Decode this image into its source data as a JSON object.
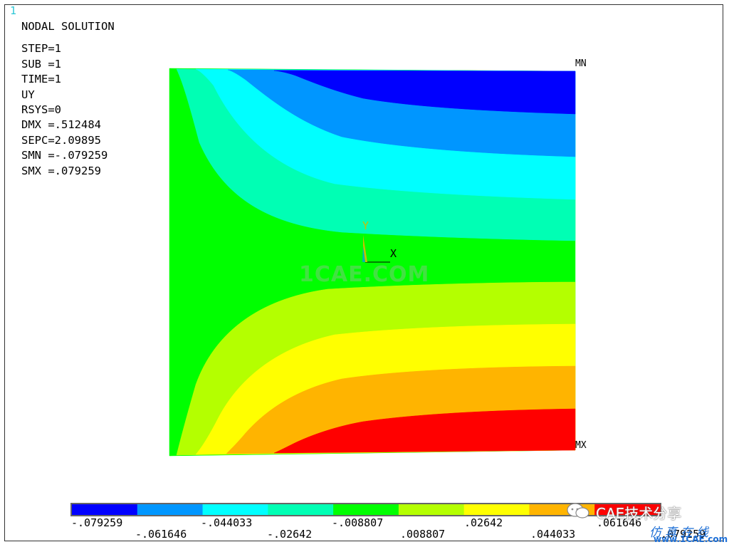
{
  "window_number": "1",
  "info": {
    "title": "NODAL SOLUTION",
    "lines": [
      "STEP=1",
      "SUB =1",
      "TIME=1",
      "UY",
      "RSYS=0",
      "DMX =.512484",
      "SEPC=2.09895",
      "SMN =-.079259",
      "SMX =.079259"
    ]
  },
  "markers": {
    "min": "MN",
    "max": "MX"
  },
  "axis": {
    "y": "Y",
    "x": "X",
    "y_color": "#c9c000",
    "x_color": "#000000"
  },
  "colors": [
    "#0000ff",
    "#0096ff",
    "#00ffff",
    "#00ffb4",
    "#00ff00",
    "#b4ff00",
    "#ffff00",
    "#ffb400",
    "#ff0000"
  ],
  "legend": {
    "values_top": [
      "-.079259",
      "-.044033",
      "-.008807",
      ".02642",
      ".061646"
    ],
    "values_bottom": [
      "-.061646",
      "-.02642",
      ".008807",
      ".044033",
      ".079259"
    ]
  },
  "watermark": "1CAE.COM",
  "brand": {
    "text": "CAE技术分享",
    "site_text": "仿真在线",
    "site_url": "www.1CAE.com"
  }
}
